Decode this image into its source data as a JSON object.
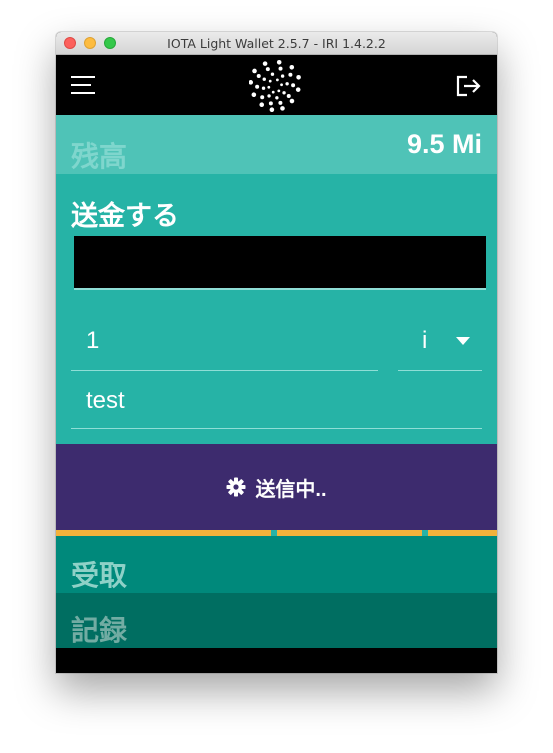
{
  "window": {
    "title": "IOTA Light Wallet 2.5.7 - IRI 1.4.2.2"
  },
  "topbar": {
    "menu_icon": "hamburger-menu-icon",
    "logo": "iota-logo",
    "logout_icon": "logout-icon"
  },
  "balance": {
    "label": "残高",
    "value": "9.5 Mi"
  },
  "send": {
    "title": "送金する",
    "address_value": "",
    "amount_value": "1",
    "unit_value": "i",
    "tag_value": "test",
    "button_label": "送信中..",
    "button_icon": "gear-icon"
  },
  "progress": {
    "segments": 3
  },
  "receive": {
    "label": "受取"
  },
  "history": {
    "label": "記録"
  },
  "colors": {
    "topbar": "#000000",
    "balance_bg": "#4fc3b7",
    "send_bg": "#26b3a6",
    "button_bg": "#3d2b6e",
    "progress": "#f3b23b",
    "receive_bg": "#00897b",
    "history_bg": "#006e61"
  }
}
